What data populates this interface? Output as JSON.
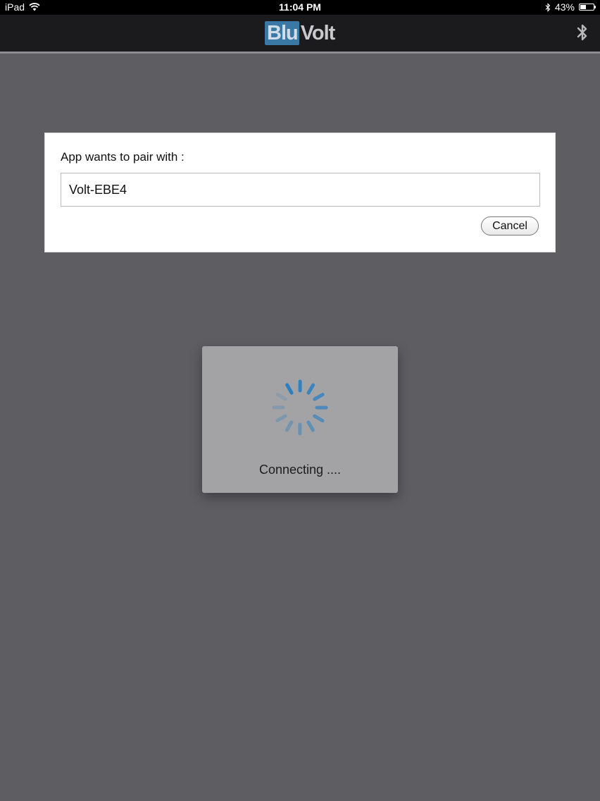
{
  "status_bar": {
    "device": "iPad",
    "time": "11:04 PM",
    "battery": "43%",
    "battery_level": 0.43,
    "icons": [
      "wifi-icon",
      "bluetooth-icon",
      "battery-icon"
    ]
  },
  "nav": {
    "logo_part1": "Blu",
    "logo_part2": "Volt",
    "icon": "bluetooth-icon"
  },
  "pair_dialog": {
    "label": "App wants to pair with :",
    "device_name": "Volt-EBE4",
    "cancel_label": "Cancel"
  },
  "loading": {
    "text": "Connecting ....",
    "icon": "spinner-icon"
  },
  "colors": {
    "background": "#5e5d62",
    "nav_background": "#1b1b1d",
    "brand_blue": "#3a79a6",
    "spinner_blue": "#2b7fc2"
  }
}
